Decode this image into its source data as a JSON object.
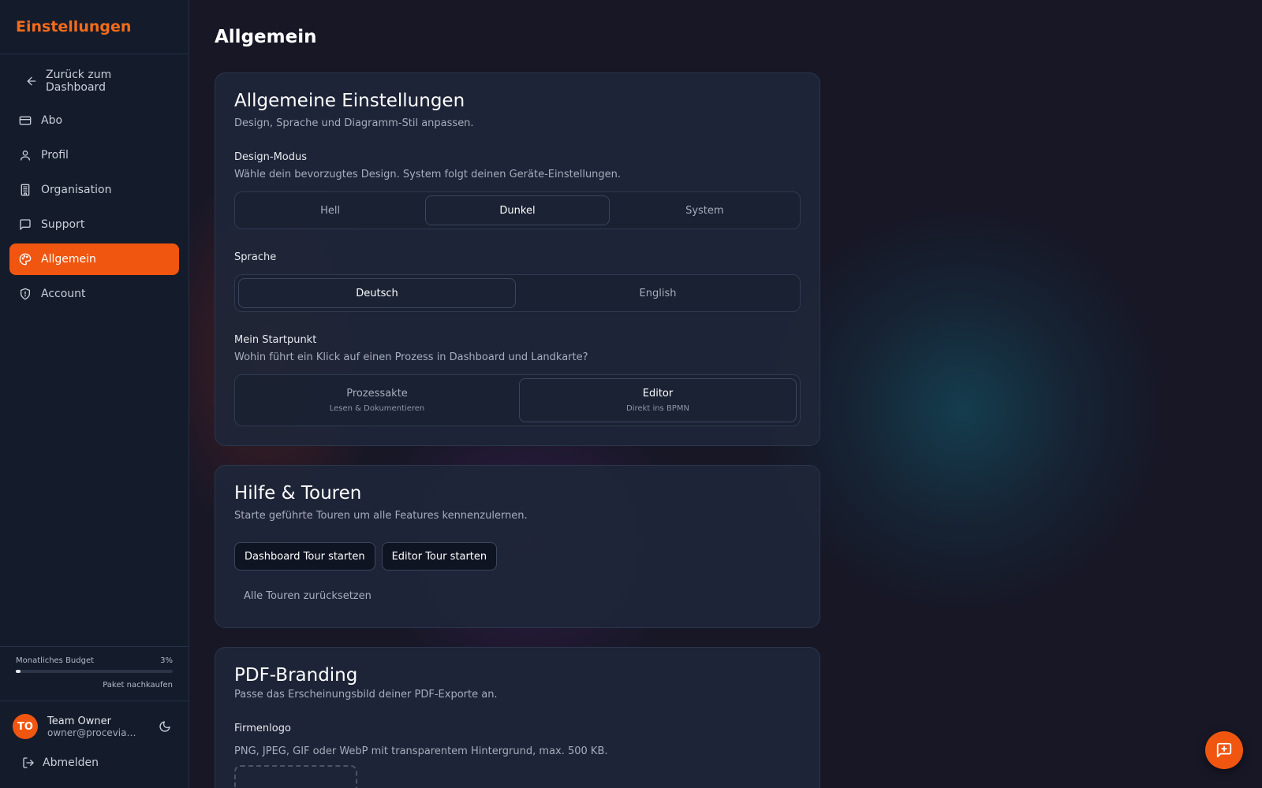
{
  "sidebar": {
    "title": "Einstellungen",
    "back_label": "Zurück zum Dashboard",
    "items": [
      {
        "label": "Abo",
        "icon": "credit-card-icon"
      },
      {
        "label": "Profil",
        "icon": "user-icon"
      },
      {
        "label": "Organisation",
        "icon": "building-icon"
      },
      {
        "label": "Support",
        "icon": "message-square-icon"
      },
      {
        "label": "Allgemein",
        "icon": "palette-icon",
        "active": true
      },
      {
        "label": "Account",
        "icon": "shield-icon"
      }
    ],
    "budget": {
      "label": "Monatliches Budget",
      "percent_text": "3%",
      "percent": 3,
      "buy_label": "Paket nachkaufen"
    },
    "user": {
      "initials": "TO",
      "name": "Team Owner",
      "email": "owner@procevia-te..."
    },
    "logout_label": "Abmelden"
  },
  "main": {
    "page_title": "Allgemein",
    "general": {
      "title": "Allgemeine Einstellungen",
      "description": "Design, Sprache und Diagramm-Stil anpassen.",
      "design_mode": {
        "label": "Design-Modus",
        "hint": "Wähle dein bevorzugtes Design. System folgt deinen Geräte-Einstellungen.",
        "options": [
          "Hell",
          "Dunkel",
          "System"
        ],
        "selected": "Dunkel"
      },
      "language": {
        "label": "Sprache",
        "options": [
          "Deutsch",
          "English"
        ],
        "selected": "Deutsch"
      },
      "start_point": {
        "label": "Mein Startpunkt",
        "hint": "Wohin führt ein Klick auf einen Prozess in Dashboard und Landkarte?",
        "options": [
          {
            "label": "Prozessakte",
            "sub": "Lesen & Dokumentieren"
          },
          {
            "label": "Editor",
            "sub": "Direkt ins BPMN"
          }
        ],
        "selected": "Editor"
      }
    },
    "help": {
      "title": "Hilfe & Touren",
      "description": "Starte geführte Touren um alle Features kennenzulernen.",
      "dashboard_tour": "Dashboard Tour starten",
      "editor_tour": "Editor Tour starten",
      "reset_tours": "Alle Touren zurücksetzen"
    },
    "pdf": {
      "title": "PDF-Branding",
      "description": "Passe das Erscheinungsbild deiner PDF-Exporte an.",
      "logo_label": "Firmenlogo",
      "logo_hint": "PNG, JPEG, GIF oder WebP mit transparentem Hintergrund, max. 500 KB."
    }
  },
  "fab_icon": "message-plus-icon",
  "colors": {
    "accent": "#f0560f",
    "brand_text": "#f46b1a",
    "background": "#171726",
    "sidebar": "#141c2c"
  }
}
